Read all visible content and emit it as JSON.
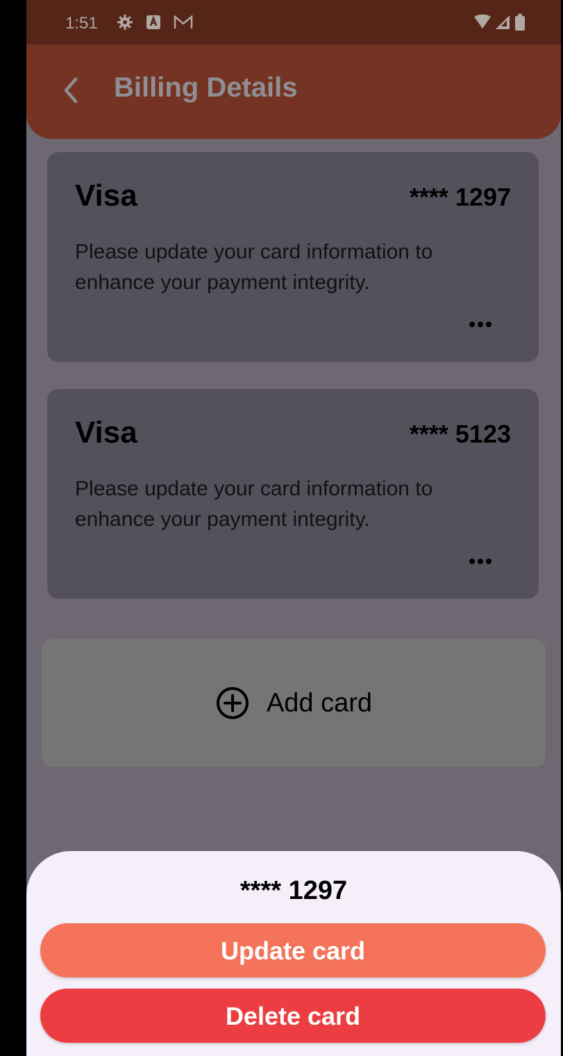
{
  "status_bar": {
    "time": "1:51",
    "left_icons": [
      "gear-icon",
      "a-badge-icon",
      "gmail-icon"
    ],
    "right_icons": [
      "wifi-icon",
      "signal-icon",
      "battery-icon"
    ]
  },
  "app_bar": {
    "title": "Billing Details",
    "back_icon": "chevron-left-icon"
  },
  "cards": [
    {
      "brand": "Visa",
      "number": "**** 1297",
      "message": "Please update your card information to enhance your payment integrity.",
      "more_icon": "more-horizontal-icon"
    },
    {
      "brand": "Visa",
      "number": "**** 5123",
      "message": "Please update your card information to enhance your payment integrity.",
      "more_icon": "more-horizontal-icon"
    }
  ],
  "add_card": {
    "label": "Add card",
    "icon": "add-circle-icon"
  },
  "bottom_sheet": {
    "title": "**** 1297",
    "update_label": "Update card",
    "delete_label": "Delete card"
  },
  "colors": {
    "update_button": "#f4735a",
    "delete_button": "#ec3e42",
    "app_bar": "#753423",
    "sheet_background": "#f5effa"
  }
}
